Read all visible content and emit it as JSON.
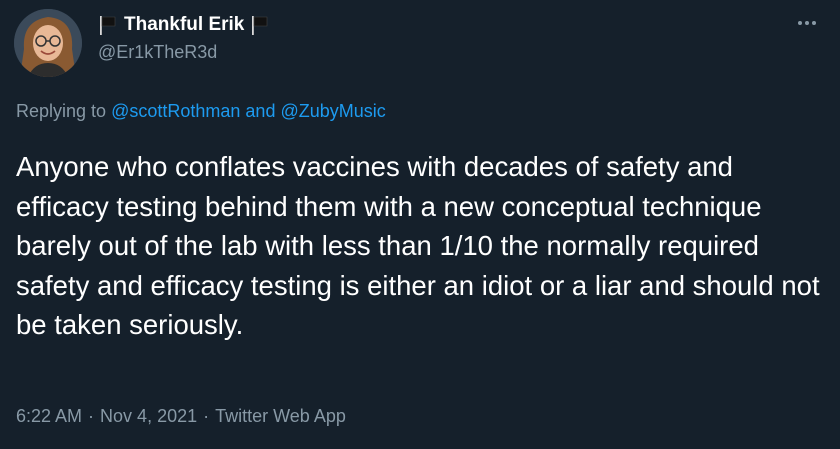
{
  "author": {
    "display_name": "Thankful Erik",
    "handle": "@Er1kTheR3d"
  },
  "reply": {
    "prefix": "Replying to",
    "user1": "@scottRothman",
    "conjunction": "and",
    "user2": "@ZubyMusic"
  },
  "tweet": {
    "text": "Anyone who conflates vaccines with decades of safety and efficacy testing behind them with a new conceptual technique barely out of the lab with less than 1/10 the normally required safety and efficacy testing is either an idiot or a liar and should not be taken seriously."
  },
  "meta": {
    "time": "6:22 AM",
    "date": "Nov 4, 2021",
    "source": "Twitter Web App",
    "separator": "·"
  },
  "icons": {
    "flag": "black-flag-icon",
    "more": "more-options-icon"
  },
  "colors": {
    "background": "#15202b",
    "primary_text": "#ffffff",
    "secondary_text": "#8899a6",
    "link": "#1d9bf0"
  }
}
